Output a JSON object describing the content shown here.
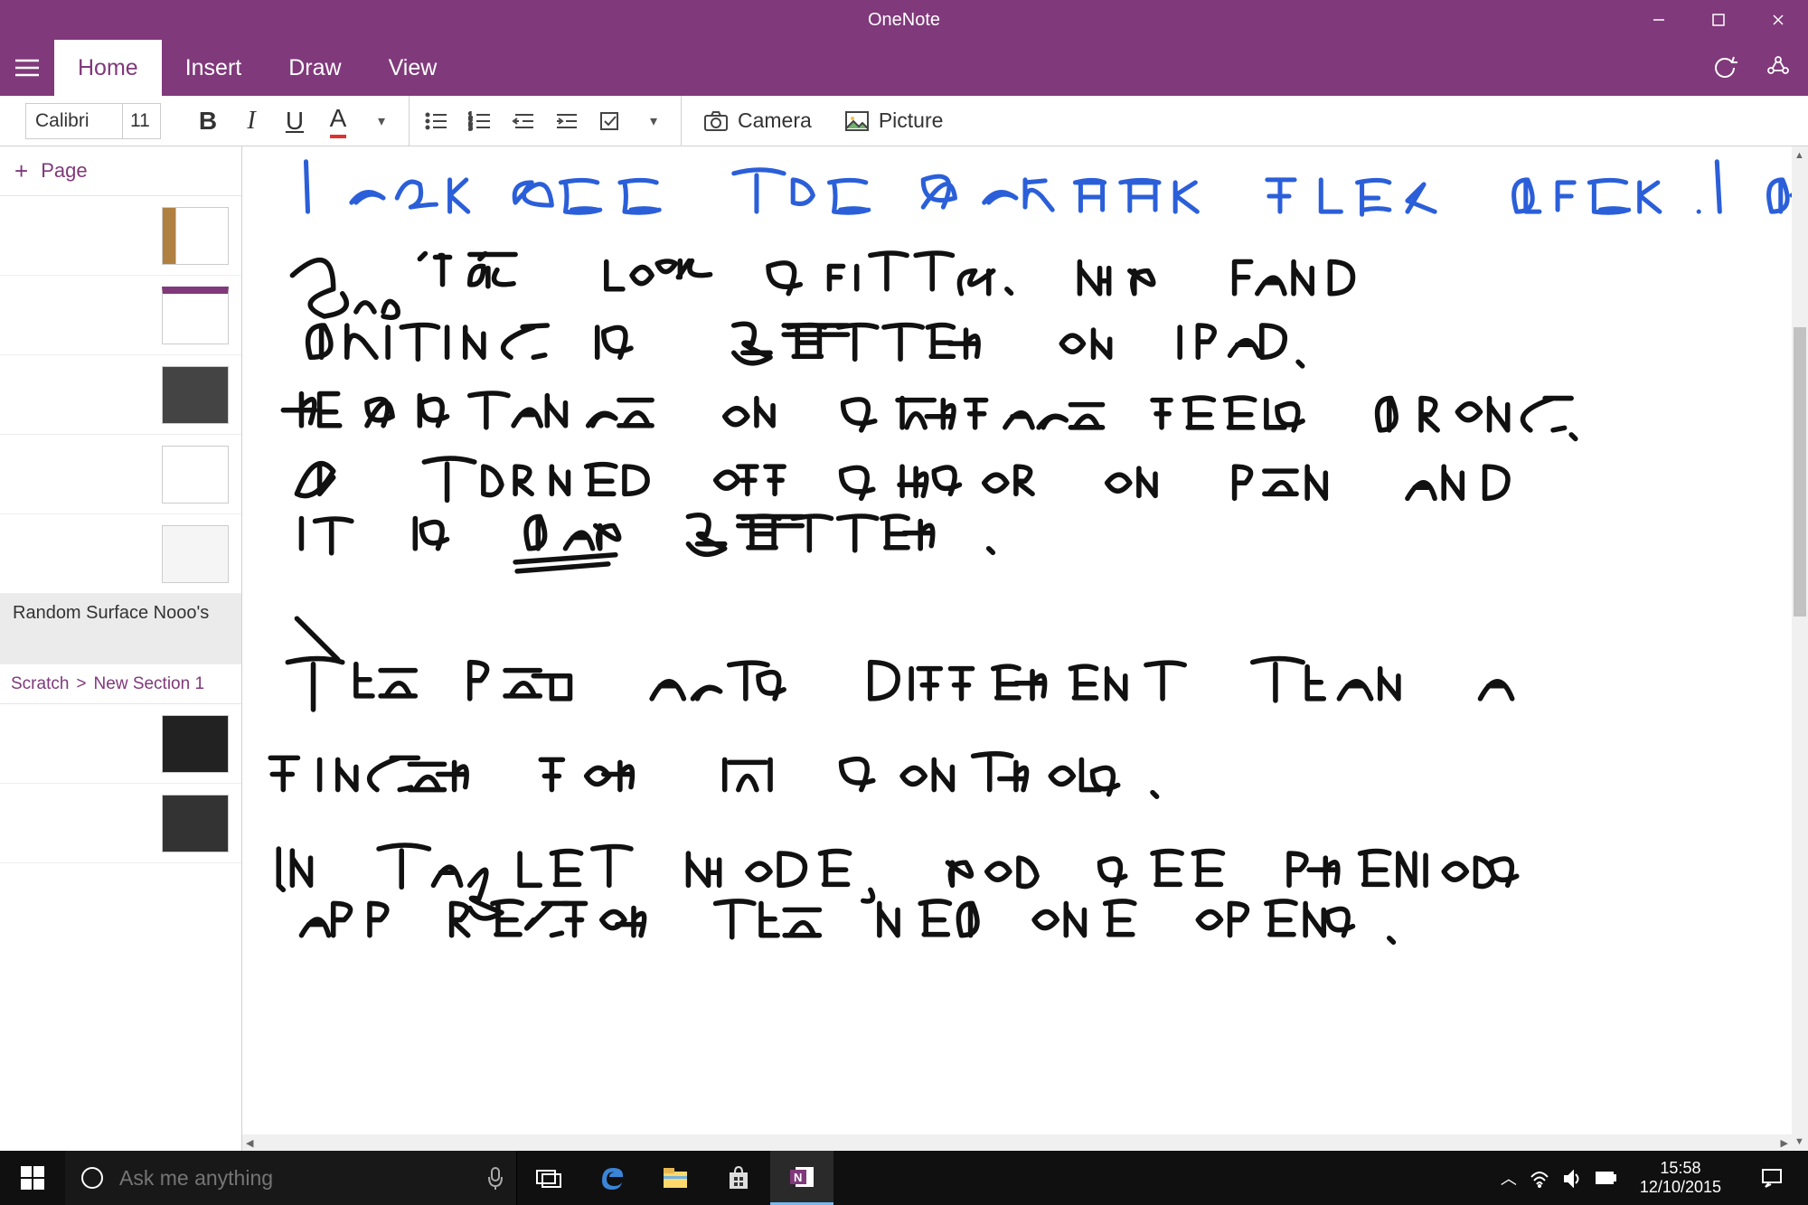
{
  "app_title": "OneNote",
  "tabs": {
    "home": "Home",
    "insert": "Insert",
    "draw": "Draw",
    "view": "View"
  },
  "toolbar": {
    "font_name": "Calibri",
    "font_size": "11",
    "camera": "Camera",
    "picture": "Picture"
  },
  "sidebar": {
    "add_page": "Page",
    "selected_page_title": "Random Surface Nooo's",
    "breadcrumb_notebook": "Scratch",
    "breadcrumb_sep": ">",
    "breadcrumb_section": "New Section 1"
  },
  "ink_content": {
    "line1": "I CAN SEE THE SCREEN FLEX WHEN I WRITE",
    "line2": "But \"Ink\" looks shitty. My hand",
    "line3": "writing is better on iPad.",
    "line4": "Resistance on Surface feels wrong.",
    "line5": "Ok turned off cursor on pen and",
    "line6": "it is way better.",
    "line7": "The pen acts different than a",
    "line8": "finger for UI controls.",
    "line9": "In tablet mode, you see previous",
    "line10": "app before the new one opens."
  },
  "taskbar": {
    "search_placeholder": "Ask me anything",
    "time": "15:58",
    "date": "12/10/2015"
  },
  "colors": {
    "brand": "#80397B",
    "ink_blue": "#2B5FD9",
    "ink_black": "#111111"
  }
}
